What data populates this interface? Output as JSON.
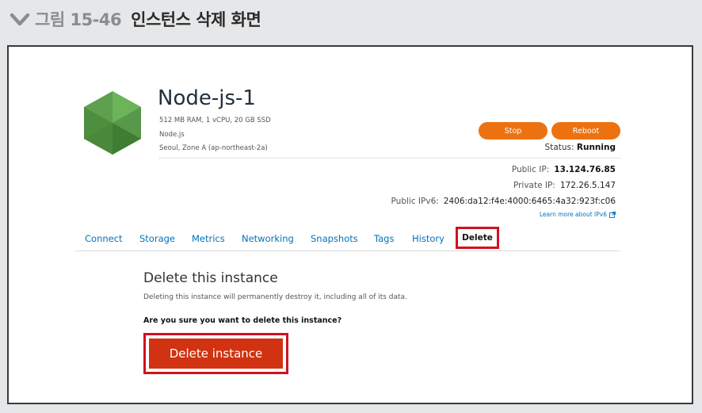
{
  "figure": {
    "number": "그림 15-46",
    "title": "인스턴스 삭제 화면"
  },
  "instance": {
    "name": "Node-js-1",
    "spec": "512 MB RAM, 1 vCPU, 20 GB SSD",
    "platform": "Node.js",
    "zone": "Seoul, Zone A (ap-northeast-2a)",
    "stop_label": "Stop",
    "reboot_label": "Reboot",
    "status_label": "Status:",
    "status_value": "Running",
    "public_ip_label": "Public IP:",
    "public_ip": "13.124.76.85",
    "private_ip_label": "Private IP:",
    "private_ip": "172.26.5.147",
    "public_ipv6_label": "Public IPv6:",
    "public_ipv6": "2406:da12:f4e:4000:6465:4a32:923f:c06",
    "ipv6_link": "Learn more about IPv6"
  },
  "tabs": [
    {
      "label": "Connect"
    },
    {
      "label": "Storage"
    },
    {
      "label": "Metrics"
    },
    {
      "label": "Networking"
    },
    {
      "label": "Snapshots"
    },
    {
      "label": "Tags"
    },
    {
      "label": "History"
    },
    {
      "label": "Delete"
    }
  ],
  "delete_section": {
    "title": "Delete this instance",
    "description": "Deleting this instance will permanently destroy it, including all of its data.",
    "confirm": "Are you sure you want to delete this instance?",
    "button_label": "Delete instance"
  },
  "colors": {
    "accent_orange": "#ec7211",
    "danger_red": "#d13212",
    "highlight_red": "#d0121f",
    "link_blue": "#0073bb",
    "logo_green": "#5fa04e"
  },
  "icons": {
    "figure": "chevron-down-icon",
    "logo": "nodejs-hexagon-logo",
    "external": "external-link-icon"
  }
}
